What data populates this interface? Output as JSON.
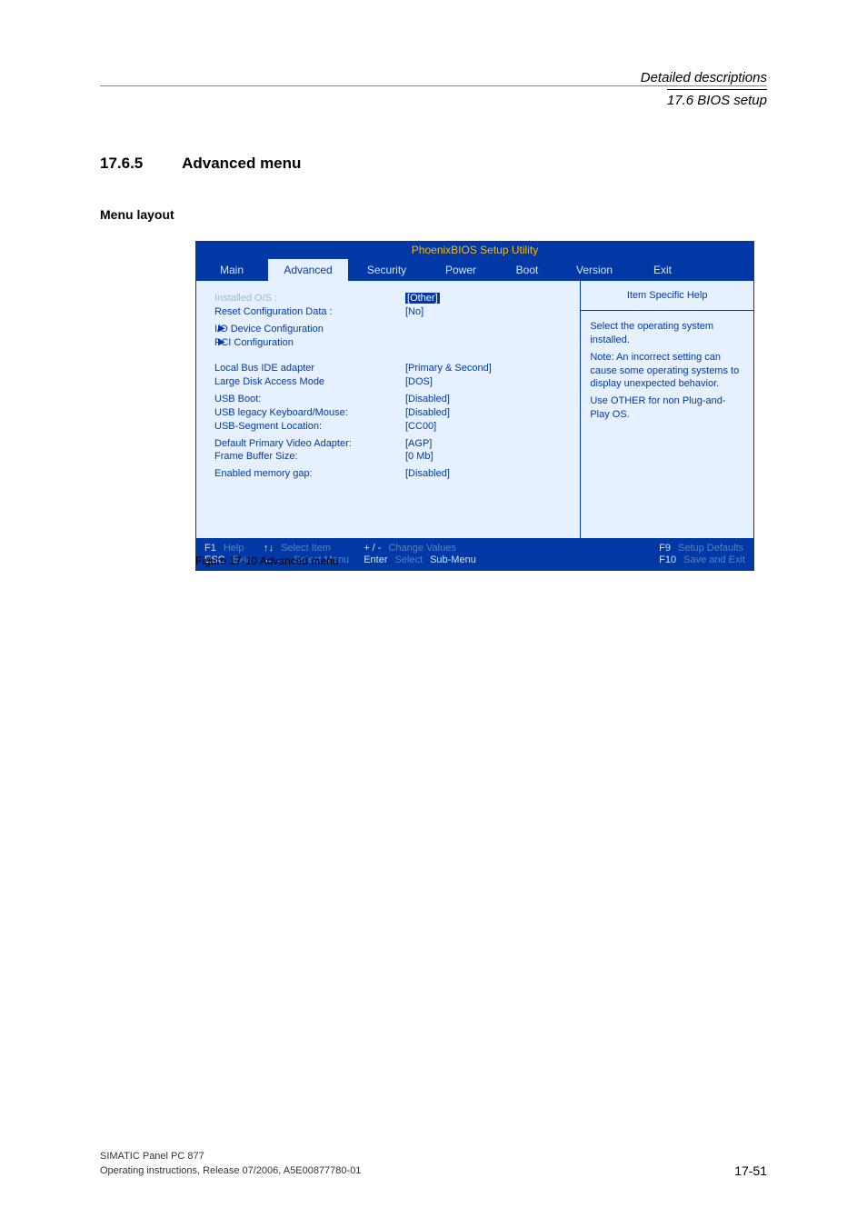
{
  "header": {
    "title1": "Detailed descriptions",
    "title2": "17.6 BIOS setup"
  },
  "section": {
    "number": "17.6.5",
    "title": "Advanced menu",
    "subheading": "Menu layout"
  },
  "bios": {
    "title": "PhoenixBIOS Setup Utility",
    "tabs": {
      "main": "Main",
      "advanced": "Advanced",
      "security": "Security",
      "power": "Power",
      "boot": "Boot",
      "version": "Version",
      "exit": "Exit"
    },
    "fields": {
      "installed_os_label": "Installed O/S :",
      "installed_os_value": "Other",
      "reset_config_label": "Reset Configuration Data :",
      "reset_config_value": "[No]",
      "io_device_label": "I/O Device Configuration",
      "pci_config_label": "PCI Configuration",
      "local_bus_label": "Local Bus IDE adapter",
      "local_bus_value": "[Primary & Second]",
      "large_disk_label": "Large Disk Access Mode",
      "large_disk_value": "[DOS]",
      "usb_boot_label": "USB Boot:",
      "usb_boot_value": "[Disabled]",
      "usb_legacy_label": "USB legacy Keyboard/Mouse:",
      "usb_legacy_value": "[Disabled]",
      "usb_segment_label": "USB-Segment Location:",
      "usb_segment_value": "[CC00]",
      "default_video_label": "Default Primary Video Adapter:",
      "default_video_value": "[AGP]",
      "frame_buffer_label": "Frame Buffer Size:",
      "frame_buffer_value": "[0 Mb]",
      "memory_gap_label": "Enabled memory gap:",
      "memory_gap_value": "[Disabled]"
    },
    "help": {
      "title": "Item Specific Help",
      "p1": "Select the operating system installed.",
      "p2": "Note: An incorrect setting can cause some operating systems to display unexpected behavior.",
      "p3": "Use OTHER for non Plug-and-Play OS."
    },
    "footer": {
      "f1": "F1",
      "help": "Help",
      "esc": "ESC",
      "exit": "Exit",
      "select_item": "Select Item",
      "select_menu": "Select Menu",
      "plusminus": "+ / -",
      "enter": "Enter",
      "change_values": "Change Values",
      "select": "Select",
      "submenu": "Sub-Menu",
      "f9": "F9",
      "setup_defaults": "Setup Defaults",
      "f10": "F10",
      "save_exit": "Save and Exit"
    }
  },
  "figure_caption": "Figure 17-10  Advanced menu",
  "pagefooter": {
    "line1": "SIMATIC Panel PC 877",
    "line2": "Operating instructions, Release 07/2006, A5E00877780-01",
    "pagenum": "17-51"
  }
}
